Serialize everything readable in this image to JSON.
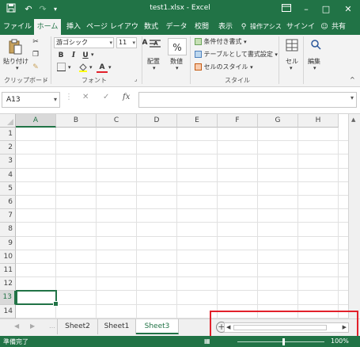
{
  "window": {
    "title": "test1.xlsx - Excel",
    "save_icon": "save-icon",
    "undo_icon": "undo-icon",
    "redo_icon": "redo-icon",
    "ribbon_display_icon": "ribbon-display-icon",
    "minimize": "–",
    "maximize": "□",
    "close": "✕"
  },
  "tabs": {
    "file": "ファイル",
    "home": "ホーム",
    "insert": "挿入",
    "page_layout": "ページ レイアウト",
    "formulas": "数式",
    "data": "データ",
    "review": "校閲",
    "view": "表示",
    "tell_me": "操作アシス",
    "signin": "サインイン",
    "share": "共有"
  },
  "ribbon": {
    "clipboard": {
      "paste": "貼り付け",
      "group_label": "クリップボード"
    },
    "font": {
      "font_name": "游ゴシック",
      "font_size": "11",
      "bold": "B",
      "italic": "I",
      "underline": "U",
      "group_label": "フォント",
      "grow": "A",
      "shrink": "A",
      "font_color": "A"
    },
    "alignment": {
      "label": "配置"
    },
    "number": {
      "label": "数値",
      "symbol": "%"
    },
    "styles": {
      "conditional": "条件付き書式",
      "table": "テーブルとして書式設定",
      "cell_style": "セルのスタイル",
      "group_label": "スタイル"
    },
    "cells": {
      "label": "セル"
    },
    "editing": {
      "label": "編集"
    }
  },
  "formula_bar": {
    "name_box": "A13",
    "cancel": "✕",
    "enter": "✓",
    "fx": "fx",
    "value": ""
  },
  "grid": {
    "columns": [
      "A",
      "B",
      "C",
      "D",
      "E",
      "F",
      "G",
      "H"
    ],
    "rows": [
      "1",
      "2",
      "3",
      "4",
      "5",
      "6",
      "7",
      "8",
      "9",
      "10",
      "11",
      "12",
      "13",
      "14"
    ],
    "selected_column": "A",
    "selected_row": "13"
  },
  "sheets": {
    "tabs": [
      "Sheet2",
      "Sheet1",
      "Sheet3"
    ],
    "active": "Sheet3",
    "add_label": "+"
  },
  "status": {
    "text": "準備完了",
    "zoom": "100%"
  },
  "colors": {
    "accent": "#217346",
    "highlight": "#e2202a"
  }
}
